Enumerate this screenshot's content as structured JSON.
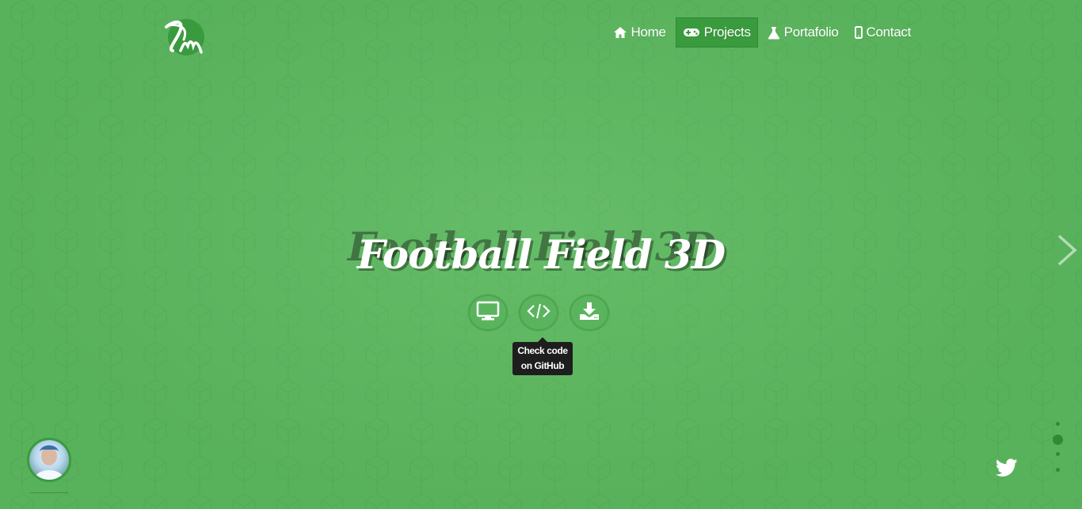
{
  "logo": {
    "text": "Dm"
  },
  "nav": {
    "items": [
      {
        "label": "Home",
        "icon": "home-icon",
        "active": false
      },
      {
        "label": "Projects",
        "icon": "gamepad-icon",
        "active": true
      },
      {
        "label": "Portafolio",
        "icon": "flask-icon",
        "active": false
      },
      {
        "label": "Contact",
        "icon": "mobile-icon",
        "active": false
      }
    ]
  },
  "hero": {
    "title": "Football Field 3D",
    "actions": [
      {
        "icon": "monitor-icon"
      },
      {
        "icon": "code-icon"
      },
      {
        "icon": "download-icon"
      }
    ],
    "tooltip": {
      "line1": "Check code",
      "line2": "on GitHub"
    }
  },
  "social": {
    "icon": "twitter-icon"
  },
  "pagination": {
    "count": 4,
    "active_index": 1
  },
  "colors": {
    "background": "#5cb85f",
    "accent": "#3a9a3e",
    "tooltip_bg": "#1e1e1e",
    "text": "#ffffff"
  }
}
